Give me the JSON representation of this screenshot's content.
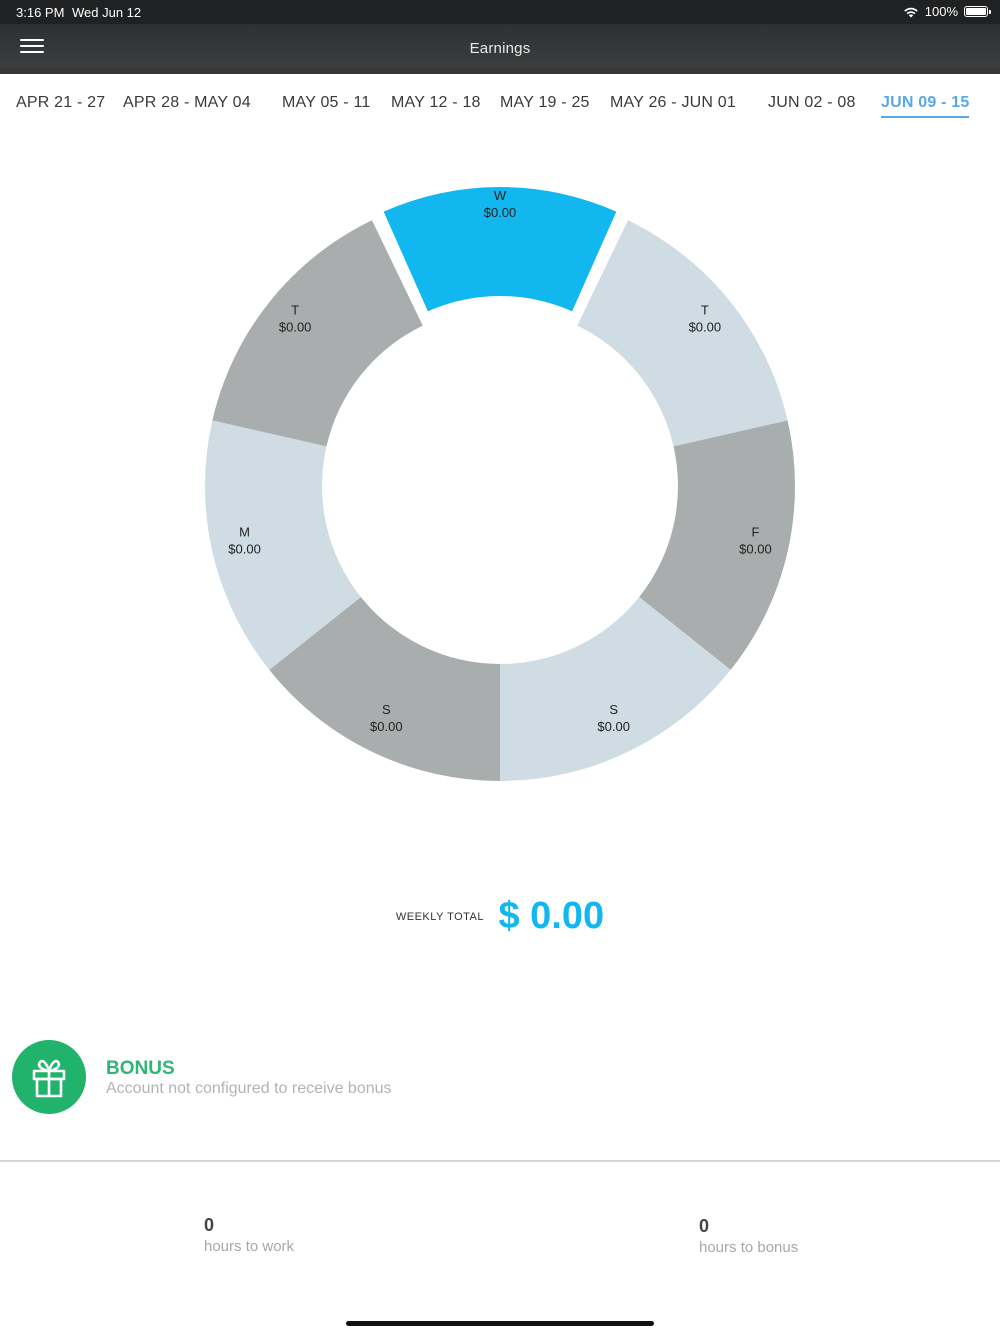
{
  "status": {
    "time": "3:16 PM",
    "date": "Wed Jun 12",
    "battery": "100%"
  },
  "nav": {
    "title": "Earnings"
  },
  "weeks": [
    {
      "label": "APR 21 - 27"
    },
    {
      "label": "APR 28 - MAY 04"
    },
    {
      "label": "MAY 05 - 11"
    },
    {
      "label": "MAY 12 - 18"
    },
    {
      "label": "MAY 19 - 25"
    },
    {
      "label": "MAY 26 - JUN 01"
    },
    {
      "label": "JUN 02 - 08"
    },
    {
      "label": "JUN 09 - 15",
      "active": true
    }
  ],
  "days": [
    {
      "day": "W",
      "amount": "$0.00",
      "color": "#13b7ef",
      "selected": true
    },
    {
      "day": "T",
      "amount": "$0.00",
      "color": "#d0dce3"
    },
    {
      "day": "F",
      "amount": "$0.00",
      "color": "#aaadad"
    },
    {
      "day": "S",
      "amount": "$0.00",
      "color": "#d0dce3"
    },
    {
      "day": "S",
      "amount": "$0.00",
      "color": "#aaadad"
    },
    {
      "day": "M",
      "amount": "$0.00",
      "color": "#d0dce3"
    },
    {
      "day": "T",
      "amount": "$0.00",
      "color": "#aaadad"
    }
  ],
  "weekly_total": {
    "label": "WEEKLY TOTAL",
    "amount": "$ 0.00"
  },
  "bonus": {
    "title": "BONUS",
    "subtitle": "Account not configured to receive bonus"
  },
  "stats": {
    "hours_to_work": {
      "value": "0",
      "label": "hours to work"
    },
    "hours_to_bonus": {
      "value": "0",
      "label": "hours to bonus"
    }
  },
  "colors": {
    "accent": "#13b7ef",
    "bonus_green": "#21b36c",
    "active_tab": "#5aa7e6"
  }
}
